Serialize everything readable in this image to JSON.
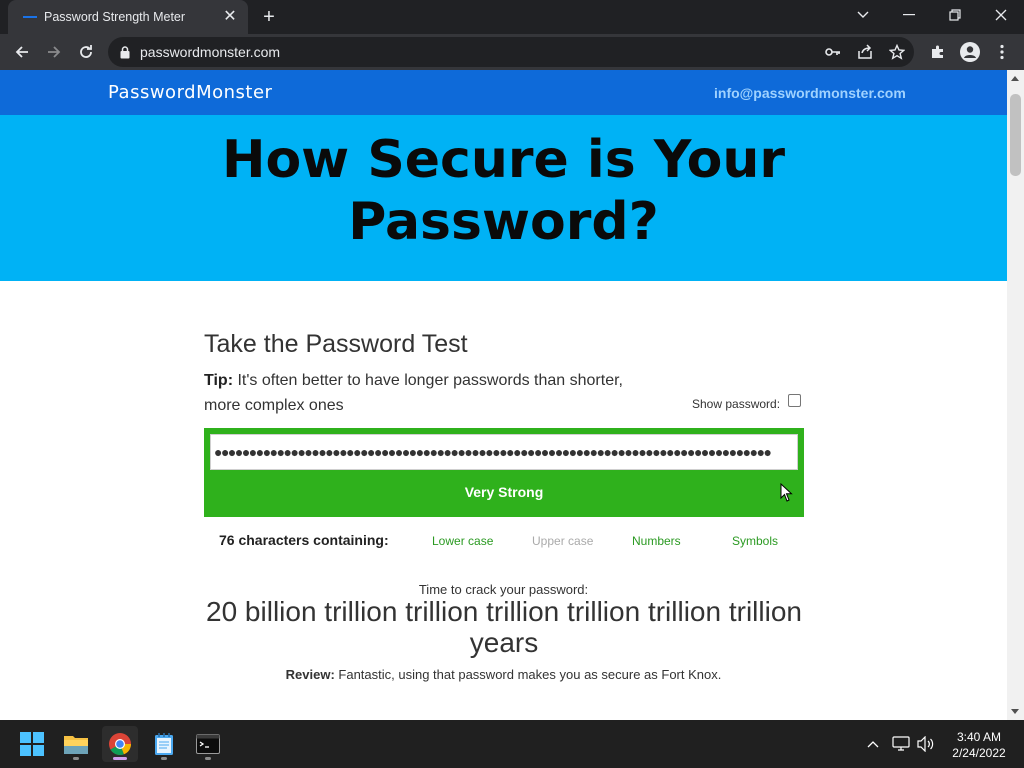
{
  "browser": {
    "tab_title": "Password Strength Meter",
    "url": "passwordmonster.com"
  },
  "site": {
    "logo": "PasswordMonster",
    "email": "info@passwordmonster.com",
    "hero_line1": "How Secure is Your",
    "hero_line2": "Password?"
  },
  "test": {
    "heading": "Take the Password Test",
    "tip_label": "Tip:",
    "tip_text": " It's often better to have longer passwords than shorter, more complex ones",
    "show_password_label": "Show password:",
    "password_masked": "●●●●●●●●●●●●●●●●●●●●●●●●●●●●●●●●●●●●●●●●●●●●●●●●●●●●●●●●●●●●●●●●●●●●●●●●●●●●●●●●",
    "strength": "Very Strong",
    "chars_count": "76 characters containing:",
    "criteria": [
      {
        "label": "Lower case",
        "met": true
      },
      {
        "label": "Upper case",
        "met": false
      },
      {
        "label": "Numbers",
        "met": true
      },
      {
        "label": "Symbols",
        "met": true
      }
    ],
    "crack_label": "Time to crack your password:",
    "crack_value": "20 billion trillion trillion trillion trillion trillion trillion years",
    "review_label": "Review:",
    "review_text": " Fantastic, using that password makes you as secure as Fort Knox."
  },
  "taskbar": {
    "time": "3:40 AM",
    "date": "2/24/2022"
  },
  "colors": {
    "header_blue": "#0e6ad9",
    "hero_cyan": "#00b2f5",
    "meter_green": "#2fb11c",
    "criteria_met": "#2b9a22",
    "criteria_unmet": "#aaaaaa"
  }
}
